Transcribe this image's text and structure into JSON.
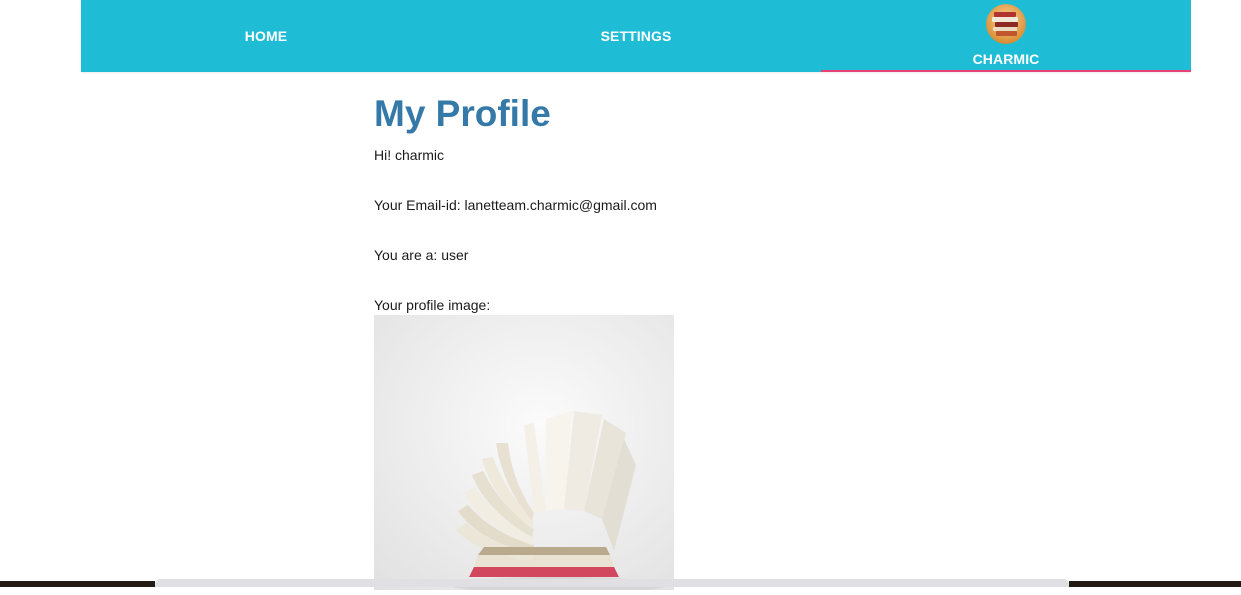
{
  "nav": {
    "home_label": "HOME",
    "settings_label": "SETTINGS",
    "user_label": "CHARMIC",
    "active_tab": "CHARMIC",
    "bar_color": "#1fbdd5",
    "indicator_color": "#e6427a"
  },
  "profile": {
    "title": "My Profile",
    "greeting": "Hi! charmic",
    "email_line": "Your Email-id: lanetteam.charmic@gmail.com",
    "role_line": "You are a: user",
    "image_label": "Your profile image:",
    "title_color": "#3579a8"
  },
  "icons": {
    "avatar": "books-stack-avatar-icon",
    "profile_image": "open-book-image"
  }
}
